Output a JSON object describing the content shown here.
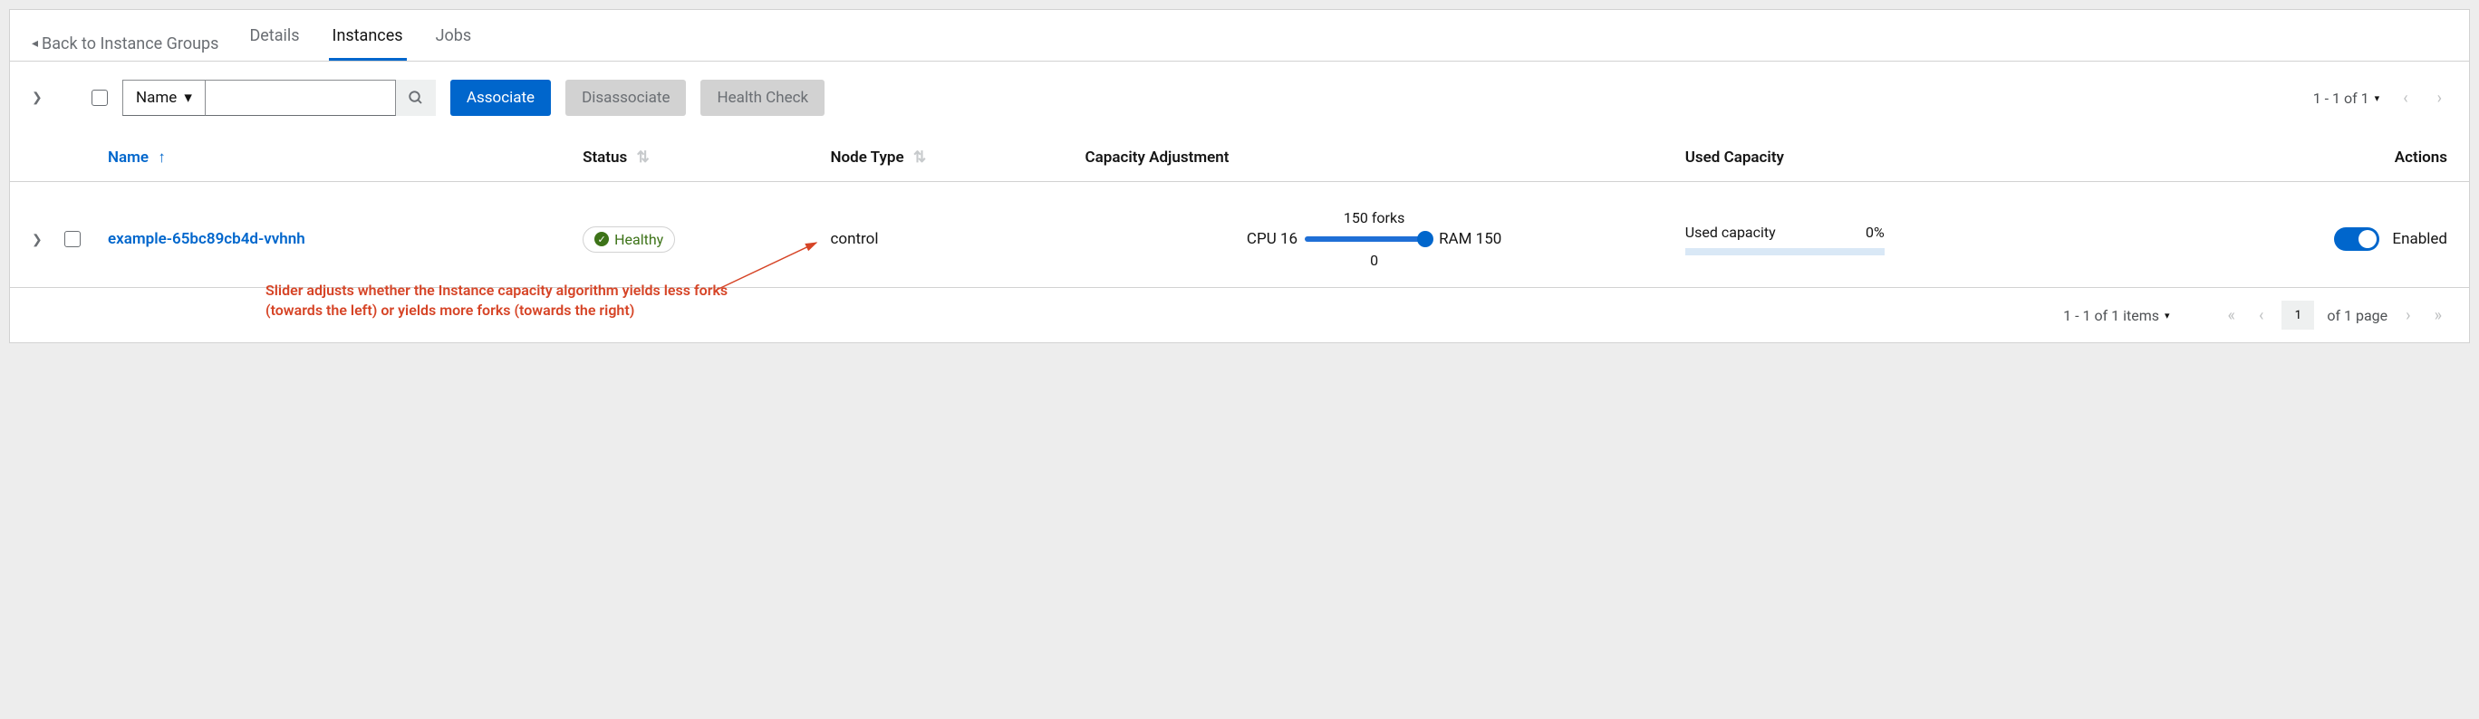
{
  "back_link": "Back to Instance Groups",
  "tabs": {
    "details": "Details",
    "instances": "Instances",
    "jobs": "Jobs"
  },
  "filter": {
    "field": "Name",
    "placeholder": ""
  },
  "buttons": {
    "associate": "Associate",
    "disassociate": "Disassociate",
    "health_check": "Health Check"
  },
  "pager_top": "1 - 1 of 1",
  "columns": {
    "name": "Name",
    "status": "Status",
    "node_type": "Node Type",
    "capacity_adj": "Capacity Adjustment",
    "used_capacity": "Used Capacity",
    "actions": "Actions"
  },
  "row": {
    "name": "example-65bc89cb4d-vvhnh",
    "status": "Healthy",
    "node_type": "control",
    "cap_forks": "150 forks",
    "cap_cpu": "CPU 16",
    "cap_ram": "RAM 150",
    "cap_zero": "0",
    "used_label": "Used capacity",
    "used_pct": "0%",
    "enabled": "Enabled"
  },
  "annotation": "Slider adjusts whether the Instance capacity algorithm yields less forks (towards the left) or yields more forks (towards the right)",
  "footer": {
    "items": "1 - 1 of 1 items",
    "page_val": "1",
    "of_page": "of 1 page"
  }
}
